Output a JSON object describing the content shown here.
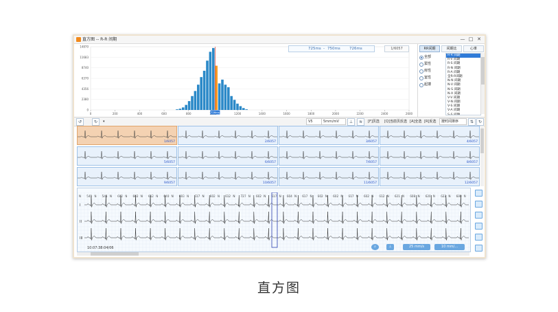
{
  "window": {
    "title": "直方图 -- R-R 间期",
    "min": "—",
    "max": "□",
    "close": "✕"
  },
  "histogram": {
    "range_from": "725ms",
    "range_sep": "-",
    "range_to": "750ms",
    "range_value": "726ms",
    "count_label": "1/6057",
    "y_ticks": [
      "14870",
      "11683",
      "8740",
      "6370",
      "4356",
      "2380",
      "0"
    ],
    "x_ticks": [
      "0",
      "200",
      "400",
      "600",
      "800",
      "1000",
      "1200",
      "1400",
      "1600",
      "1800",
      "2000",
      "2200",
      "2400",
      "2600"
    ],
    "cursor_label": "726ms",
    "bars": [
      0,
      0,
      0,
      1,
      2,
      4,
      8,
      14,
      22,
      30,
      40,
      52,
      62,
      78,
      92,
      98,
      70,
      42,
      48,
      40,
      36,
      22,
      16,
      10,
      6,
      3,
      1
    ],
    "highlight_index": 16
  },
  "right_panel": {
    "tabs": [
      "RR间期",
      "间期比",
      "心率"
    ],
    "options": [
      {
        "label": "全部",
        "on": true
      },
      {
        "label": "窦性",
        "on": false
      },
      {
        "label": "房性",
        "on": false
      },
      {
        "label": "室性",
        "on": false
      },
      {
        "label": "起搏",
        "on": false
      }
    ],
    "intervals": [
      "R-R 间期",
      "R-V 间期",
      "R-S 间期",
      "R-N 间期",
      "R-A 间期",
      "全R-R间期",
      "N-N 间期",
      "N-V 间期",
      "N-S 间期",
      "N-A 间期",
      "V-V 间期",
      "V-N 间期",
      "V-S 间期",
      "V-A 间期",
      "S-S 间期",
      "N-S-S-N 间期"
    ]
  },
  "toolbar": {
    "lead": "V5",
    "gain": "5mm/mV",
    "buttons": [
      "[F]页选",
      "[Q]当前页反选",
      "[A]全选",
      "[R]反选"
    ],
    "sort": "按时间排序"
  },
  "beats": [
    {
      "label": "1/6057"
    },
    {
      "label": "2/6057"
    },
    {
      "label": "3/6057"
    },
    {
      "label": "4/6057"
    },
    {
      "label": "5/6057"
    },
    {
      "label": "6/6057"
    },
    {
      "label": "7/6057"
    },
    {
      "label": "8/6057"
    },
    {
      "label": "9/6057"
    },
    {
      "label": "10/6057"
    },
    {
      "label": "11/6057"
    },
    {
      "label": "12/6057"
    }
  ],
  "strip": {
    "annotations": [
      "N",
      "541",
      "N",
      "541",
      "N",
      "602",
      "N",
      "602",
      "N",
      "612",
      "N",
      "640",
      "N",
      "603",
      "N",
      "617",
      "N",
      "602",
      "N",
      "612",
      "N",
      "727",
      "N",
      "602",
      "N",
      "617",
      "N",
      "604",
      "N",
      "617",
      "N",
      "602",
      "N",
      "602",
      "N",
      "617",
      "N",
      "602",
      "N",
      "612",
      "N",
      "621",
      "N",
      "608",
      "N",
      "620",
      "N",
      "622",
      "N",
      "680",
      "N"
    ],
    "timestamp": "10:07:38:04/06",
    "speed": "25 mm/s",
    "gain": "10 mm/...",
    "lead_labels": [
      "I",
      "II",
      "III"
    ]
  },
  "caption": "直方图"
}
